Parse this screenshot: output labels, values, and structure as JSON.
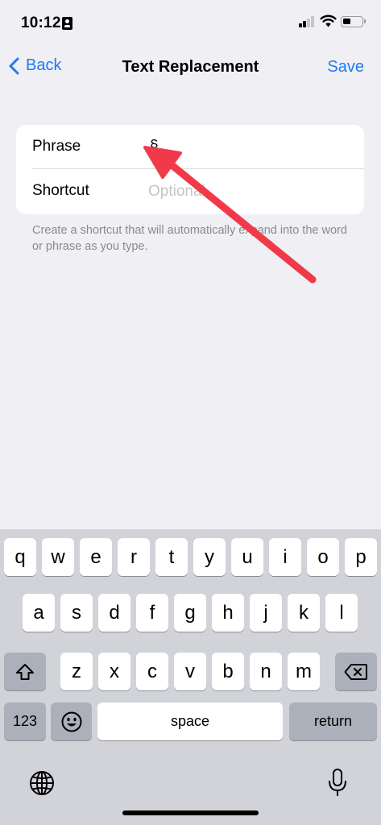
{
  "status_bar": {
    "time": "10:12",
    "icons": [
      "person-id-icon",
      "cellular-signal-icon",
      "wifi-icon",
      "battery-icon"
    ]
  },
  "nav": {
    "back_label": "Back",
    "title": "Text Replacement",
    "save_label": "Save"
  },
  "form": {
    "phrase_label": "Phrase",
    "phrase_value": "§",
    "shortcut_label": "Shortcut",
    "shortcut_placeholder": "Optional",
    "footnote": "Create a shortcut that will automatically expand into the word or phrase as you type."
  },
  "annotation": {
    "type": "arrow",
    "color": "#f03a4a",
    "points_to": "phrase-value"
  },
  "keyboard": {
    "row1": [
      "q",
      "w",
      "e",
      "r",
      "t",
      "y",
      "u",
      "i",
      "o",
      "p"
    ],
    "row2": [
      "a",
      "s",
      "d",
      "f",
      "g",
      "h",
      "j",
      "k",
      "l"
    ],
    "row3": [
      "z",
      "x",
      "c",
      "v",
      "b",
      "n",
      "m"
    ],
    "numbers_label": "123",
    "space_label": "space",
    "return_label": "return",
    "special_keys": [
      "shift-icon",
      "delete-icon",
      "emoji-icon",
      "globe-icon",
      "microphone-icon"
    ]
  },
  "colors": {
    "accent": "#1a7cf5",
    "background": "#f0eff4",
    "keyboard_background": "#d1d3d9",
    "annotation": "#f03a4a"
  }
}
